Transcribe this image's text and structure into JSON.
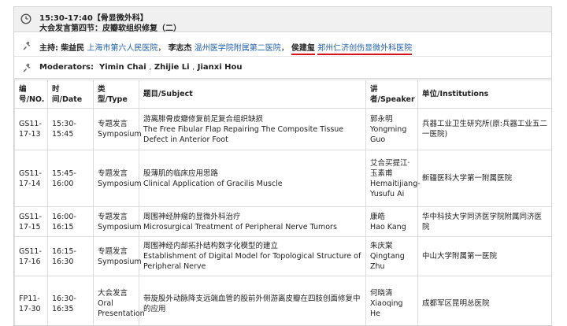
{
  "session": {
    "time": "15:30-17:40【骨显微外科】",
    "title": "大会发言第四节：皮瓣软组织修复（二）"
  },
  "hosts": {
    "label": "主持:",
    "items": [
      {
        "name": "柴益民",
        "inst": "上海市第六人民医院"
      },
      {
        "name": "李志杰",
        "inst": "温州医学院附属第二医院"
      },
      {
        "name": "侯建玺",
        "inst": "郑州仁济创伤显微外科医院"
      }
    ],
    "separators": [
      "，",
      "，"
    ]
  },
  "moderators": {
    "label": "Moderators:",
    "names": [
      "Yimin Chai",
      "Zhijie Li",
      "Jianxi Hou"
    ],
    "sep": ","
  },
  "table": {
    "headers": {
      "id": "编号/NO.",
      "time": "时间/Date",
      "type": "类型/Type",
      "subject": "题目/Subject",
      "speaker": "讲者/Speaker",
      "inst": "单位/Institutions"
    },
    "rows": [
      {
        "id": "GS11-17-13",
        "time": "15:30-15:45",
        "type_cn": "专题发言",
        "type_en": "Symposium",
        "subj_cn": "游离腓骨皮瓣修复前足复合组织缺损",
        "subj_en": "The Free Fibular Flap Repairing The Composite Tissue Defect in Anterior Foot",
        "spk_cn": "郭永明",
        "spk_en": "Yongming Guo",
        "inst": "兵器工业卫生研究所(原:兵器工业五二一医院)"
      },
      {
        "id": "GS11-17-14",
        "time": "15:45-16:00",
        "type_cn": "专题发言",
        "type_en": "Symposium",
        "subj_cn": "股薄肌的临床应用思路",
        "subj_en": "Clinical Application of Gracilis Muscle",
        "spk_cn": "艾合买提江·玉素甫",
        "spk_en": "Hemaitijiang-Yusufu Ai",
        "inst": "新疆医科大学第一附属医院"
      },
      {
        "id": "GS11-17-15",
        "time": "16:00-16:15",
        "type_cn": "专题发言",
        "type_en": "Symposium",
        "subj_cn": "周围神经肿瘤的显微外科治疗",
        "subj_en": "Microsurgical Treatment of Peripheral Nerve Tumors",
        "spk_cn": "康皓",
        "spk_en": "Hao Kang",
        "inst": "华中科技大学同济医学院附属同济医院"
      },
      {
        "id": "GS11-17-16",
        "time": "16:15-16:30",
        "type_cn": "专题发言",
        "type_en": "Symposium",
        "subj_cn": "周围神经内部拓扑结构数字化模型的建立",
        "subj_en": "Establishment of Digital Model for Topological Structure of Peripheral Nerve",
        "spk_cn": "朱庆棠",
        "spk_en": "Qingtang Zhu",
        "inst": "中山大学附属第一医院"
      },
      {
        "id": "FP11-17-30",
        "time": "16:30-16:35",
        "type_cn": "大会发言",
        "type_en": "Oral Presentation",
        "subj_cn": "带旋股外动脉降支远端血管的股前外侧游离皮瓣在四肢创面修复中的应用",
        "subj_en": "",
        "spk_cn": "何晓清",
        "spk_en": "Xiaoqing He",
        "inst": "成都军区昆明总医院"
      }
    ]
  },
  "colors": {
    "link_blue": "#1f5fa8",
    "underline_red": "#d8121b",
    "header_bg": "#f0f0f0"
  }
}
